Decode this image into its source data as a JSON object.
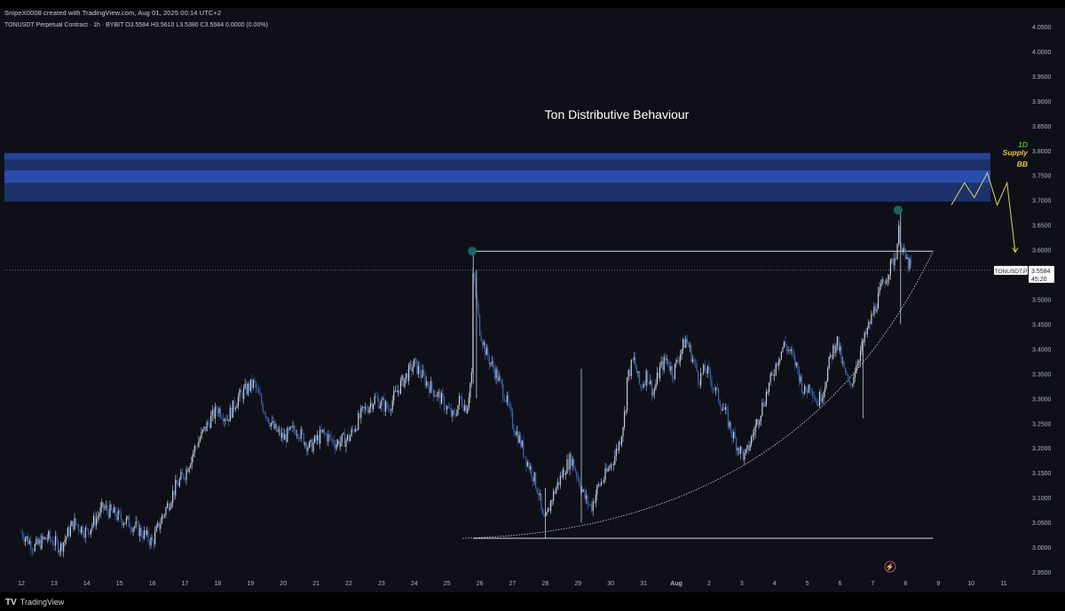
{
  "header": {
    "credit": "SnipeX0008 created with TradingView.com, Aug 01, 2025 00:14 UTC+2",
    "symbol_line": "TONUSDT Perpetual Contract · 1h · BYBIT  O3.5584  H3.5610  L3.5380  C3.5584  0.0000 (0.00%)"
  },
  "footer": {
    "brand": "TradingView",
    "brand_mark": "TV"
  },
  "colors": {
    "background": "#0f1017",
    "candle_up": "#c8cdd6",
    "candle_down": "#3b66b8",
    "zone_fill": "#2a4cae",
    "annotation_yellow": "#e0d35f",
    "marker_teal": "#1e6b68",
    "label_green": "#5aa34a",
    "label_yellow": "#e0c54a"
  },
  "chart_data": {
    "type": "candlestick",
    "title": "Ton Distributive Behaviour",
    "timeframe": "1h",
    "xlabel": "",
    "ylabel": "",
    "y_axis_side": "right",
    "ylim": [
      2.93,
      4.06
    ],
    "y_ticks": [
      "4.0500",
      "4.0000",
      "3.9500",
      "3.9000",
      "3.8500",
      "3.8000",
      "3.7500",
      "3.7000",
      "3.6500",
      "3.6000",
      "3.5500",
      "3.5000",
      "3.4500",
      "3.4000",
      "3.3500",
      "3.3000",
      "3.2500",
      "3.2000",
      "3.1500",
      "3.1000",
      "3.0500",
      "3.0000",
      "2.9500"
    ],
    "x_ticks": [
      "12",
      "13",
      "14",
      "15",
      "16",
      "17",
      "18",
      "19",
      "20",
      "21",
      "22",
      "23",
      "24",
      "25",
      "26",
      "27",
      "28",
      "29",
      "30",
      "31",
      "Aug",
      "2",
      "3",
      "4",
      "5",
      "6",
      "7",
      "8",
      "9",
      "10",
      "11"
    ],
    "last_price": {
      "symbol": "TONUSDT.P",
      "value": "3.5584",
      "countdown": "45:20"
    },
    "price_path": [
      [
        0,
        3.03
      ],
      [
        0.4,
        3.0
      ],
      [
        0.8,
        3.02
      ],
      [
        1.2,
        3.0
      ],
      [
        1.6,
        3.05
      ],
      [
        2,
        3.03
      ],
      [
        2.5,
        3.08
      ],
      [
        3,
        3.06
      ],
      [
        3.5,
        3.04
      ],
      [
        4,
        3.01
      ],
      [
        4.3,
        3.06
      ],
      [
        4.7,
        3.12
      ],
      [
        5,
        3.15
      ],
      [
        5.3,
        3.2
      ],
      [
        5.7,
        3.25
      ],
      [
        6,
        3.28
      ],
      [
        6.3,
        3.26
      ],
      [
        6.6,
        3.3
      ],
      [
        6.9,
        3.32
      ],
      [
        7.1,
        3.33
      ],
      [
        7.4,
        3.28
      ],
      [
        7.7,
        3.24
      ],
      [
        8,
        3.22
      ],
      [
        8.4,
        3.24
      ],
      [
        8.8,
        3.2
      ],
      [
        9.2,
        3.23
      ],
      [
        9.6,
        3.21
      ],
      [
        10,
        3.22
      ],
      [
        10.4,
        3.27
      ],
      [
        10.8,
        3.3
      ],
      [
        11.2,
        3.28
      ],
      [
        11.6,
        3.33
      ],
      [
        12,
        3.37
      ],
      [
        12.4,
        3.33
      ],
      [
        12.8,
        3.3
      ],
      [
        13.2,
        3.26
      ],
      [
        13.4,
        3.3
      ],
      [
        13.6,
        3.28
      ],
      [
        13.75,
        3.35
      ],
      [
        13.8,
        3.58
      ],
      [
        13.85,
        3.52
      ],
      [
        14.0,
        3.44
      ],
      [
        14.2,
        3.39
      ],
      [
        14.5,
        3.35
      ],
      [
        14.8,
        3.3
      ],
      [
        15.0,
        3.25
      ],
      [
        15.2,
        3.22
      ],
      [
        15.4,
        3.18
      ],
      [
        15.6,
        3.15
      ],
      [
        15.8,
        3.11
      ],
      [
        15.9,
        3.06
      ],
      [
        16.0,
        3.05
      ],
      [
        16.2,
        3.1
      ],
      [
        16.4,
        3.13
      ],
      [
        16.6,
        3.16
      ],
      [
        16.8,
        3.18
      ],
      [
        17.0,
        3.14
      ],
      [
        17.2,
        3.1
      ],
      [
        17.4,
        3.08
      ],
      [
        17.6,
        3.12
      ],
      [
        17.8,
        3.14
      ],
      [
        18.1,
        3.18
      ],
      [
        18.3,
        3.22
      ],
      [
        18.45,
        3.28
      ],
      [
        18.5,
        3.34
      ],
      [
        18.7,
        3.38
      ],
      [
        18.9,
        3.32
      ],
      [
        19.1,
        3.35
      ],
      [
        19.3,
        3.31
      ],
      [
        19.5,
        3.36
      ],
      [
        19.7,
        3.38
      ],
      [
        19.9,
        3.35
      ],
      [
        20.1,
        3.39
      ],
      [
        20.3,
        3.42
      ],
      [
        20.5,
        3.38
      ],
      [
        20.7,
        3.34
      ],
      [
        20.9,
        3.36
      ],
      [
        21.1,
        3.33
      ],
      [
        21.3,
        3.3
      ],
      [
        21.5,
        3.27
      ],
      [
        21.7,
        3.23
      ],
      [
        21.9,
        3.2
      ],
      [
        22.1,
        3.18
      ],
      [
        22.3,
        3.22
      ],
      [
        22.5,
        3.26
      ],
      [
        22.7,
        3.3
      ],
      [
        22.9,
        3.34
      ],
      [
        23.1,
        3.38
      ],
      [
        23.3,
        3.41
      ],
      [
        23.5,
        3.39
      ],
      [
        23.7,
        3.36
      ],
      [
        23.9,
        3.31
      ],
      [
        24.1,
        3.33
      ],
      [
        24.3,
        3.29
      ],
      [
        24.5,
        3.32
      ],
      [
        24.7,
        3.38
      ],
      [
        24.9,
        3.42
      ],
      [
        25.1,
        3.36
      ],
      [
        25.3,
        3.32
      ],
      [
        25.5,
        3.37
      ],
      [
        25.7,
        3.41
      ],
      [
        25.9,
        3.45
      ],
      [
        26.1,
        3.49
      ],
      [
        26.3,
        3.53
      ],
      [
        26.5,
        3.56
      ],
      [
        26.7,
        3.59
      ],
      [
        26.8,
        3.64
      ],
      [
        26.9,
        3.6
      ],
      [
        27.0,
        3.58
      ],
      [
        27.2,
        3.56
      ]
    ],
    "supply_zone": {
      "top": 3.795,
      "bottom": 3.697,
      "labels": [
        "1D",
        "Supply",
        "BB"
      ]
    },
    "resistance_line": {
      "price": 3.597,
      "from_day": 13.8,
      "to_day": 27.0
    },
    "support_line": {
      "price": 3.018,
      "from_day": 13.8,
      "to_day": 27.0
    },
    "ascending_curve": {
      "from": [
        16.0,
        3.018
      ],
      "to": [
        27.0,
        3.597
      ]
    },
    "high_markers": [
      {
        "day": 13.8,
        "price": 3.597
      },
      {
        "day": 26.8,
        "price": 3.68
      }
    ],
    "projection_path": [
      [
        28.4,
        3.69
      ],
      [
        28.8,
        3.735
      ],
      [
        29.1,
        3.705
      ],
      [
        29.5,
        3.755
      ],
      [
        29.8,
        3.69
      ],
      [
        30.1,
        3.735
      ],
      [
        30.35,
        3.595
      ]
    ],
    "event_icon": {
      "day": 26.8,
      "symbol": "⚡"
    }
  }
}
